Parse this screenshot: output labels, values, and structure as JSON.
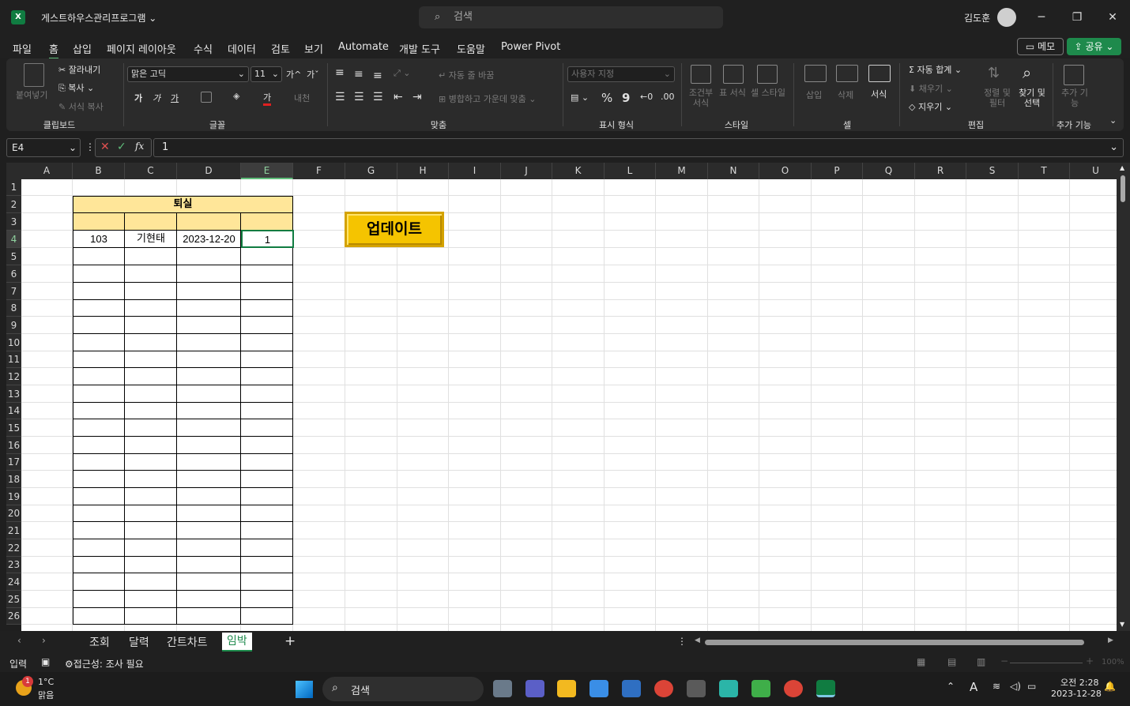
{
  "app": {
    "doc_title": "게스트하우스관리프로그램",
    "search_placeholder": "검색",
    "user": "김도훈"
  },
  "menu": [
    "파일",
    "홈",
    "삽입",
    "페이지 레이아웃",
    "수식",
    "데이터",
    "검토",
    "보기",
    "Automate",
    "개발 도구",
    "도움말",
    "Power Pivot"
  ],
  "menu_selected": "홈",
  "memo_label": "메모",
  "share_label": "공유",
  "ribbon": {
    "clipboard": {
      "paste": "붙여넣기",
      "cut": "잘라내기",
      "copy": "복사",
      "format_painter": "서식 복사",
      "group": "클립보드"
    },
    "font": {
      "name": "맑은 고딕",
      "size": "11",
      "bold": "가",
      "italic": "가",
      "underline": "가",
      "font_color": "가",
      "phonetic": "내천",
      "grow": "가^",
      "shrink": "가ˇ",
      "group": "글꼴"
    },
    "align": {
      "wrap": "자동 줄 바꿈",
      "merge": "병합하고 가운데 맞춤",
      "group": "맞춤"
    },
    "number": {
      "format": "사용자 지정",
      "percent": "%",
      "comma": "9",
      "group": "표시 형식"
    },
    "styles": {
      "conditional": "조건부 서식",
      "table": "표 서식",
      "cell": "셀 스타일",
      "group": "스타일"
    },
    "cells": {
      "insert": "삽입",
      "delete": "삭제",
      "format": "서식",
      "group": "셀"
    },
    "editing": {
      "autosum": "자동 합계",
      "fill": "채우기",
      "clear": "지우기",
      "sort": "정렬 및 필터",
      "find": "찾기 및 선택",
      "group": "편집"
    },
    "addins": {
      "label": "추가 기능",
      "group": "추가 기능"
    }
  },
  "formula": {
    "namebox": "E4",
    "value": "1"
  },
  "columns": [
    "A",
    "B",
    "C",
    "D",
    "E",
    "F",
    "G",
    "H",
    "I",
    "J",
    "K",
    "L",
    "M",
    "N",
    "O",
    "P",
    "Q",
    "R",
    "S",
    "T",
    "U"
  ],
  "selected_column": "E",
  "rows": [
    "1",
    "2",
    "3",
    "4",
    "5",
    "6",
    "7",
    "8",
    "9",
    "10",
    "11",
    "12",
    "13",
    "14",
    "15",
    "16",
    "17",
    "18",
    "19",
    "20",
    "21",
    "22",
    "23",
    "24",
    "25",
    "26"
  ],
  "selected_row": "4",
  "table": {
    "title": "퇴실",
    "row": [
      "103",
      "기현태",
      "2023-12-20",
      "1"
    ]
  },
  "update_button": "업데이트",
  "sheets": [
    "조회",
    "달력",
    "간트차트",
    "임박"
  ],
  "active_sheet": "임박",
  "status": {
    "mode": "입력",
    "accessibility": "접근성: 조사 필요",
    "zoom": "100%"
  },
  "taskbar": {
    "weather_temp": "1°C",
    "weather_desc": "맑음",
    "notif_count": "1",
    "search": "검색",
    "time": "오전 2:28",
    "date": "2023-12-28"
  },
  "colors": {
    "accent": "#107c41",
    "table_header": "#ffe699",
    "button": "#f5c400"
  }
}
